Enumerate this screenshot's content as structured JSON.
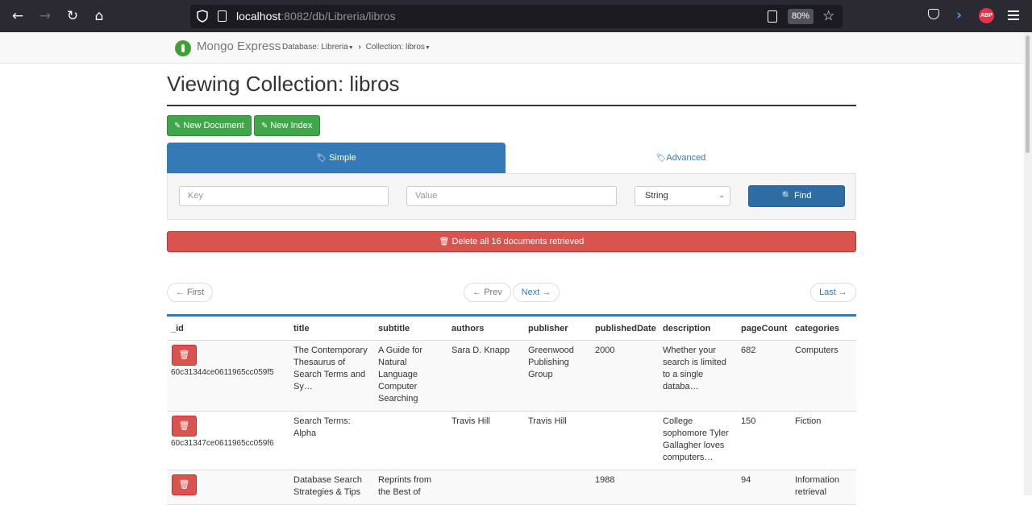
{
  "browser": {
    "url_host": "localhost",
    "url_path": ":8082/db/Libreria/libros",
    "zoom": "80%",
    "abp": "ABP"
  },
  "navbar": {
    "brand": "Mongo Express",
    "database_crumb": "Database: Libreria",
    "collection_crumb": "Collection: libros"
  },
  "page": {
    "title": "Viewing Collection: libros"
  },
  "toolbar": {
    "new_document": "New Document",
    "new_index": "New Index"
  },
  "search": {
    "tab_simple": "Simple",
    "tab_advanced": "Advanced",
    "key_placeholder": "Key",
    "value_placeholder": "Value",
    "type_selected": "String",
    "find_label": "Find"
  },
  "delete_all_label": "Delete all 16 documents retrieved",
  "pagination": {
    "first": "← First",
    "prev": "← Prev",
    "next": "Next →",
    "last": "Last →"
  },
  "table": {
    "columns": [
      "_id",
      "title",
      "subtitle",
      "authors",
      "publisher",
      "publishedDate",
      "description",
      "pageCount",
      "categories"
    ],
    "rows": [
      {
        "id": "60c31344ce0611965cc059f5",
        "title": "The Contemporary Thesaurus of Search Terms and Sy…",
        "subtitle": "A Guide for Natural Language Computer Searching",
        "authors": "Sara D. Knapp",
        "publisher": "Greenwood Publishing Group",
        "publishedDate": "2000",
        "description": "Whether your search is limited to a single databa…",
        "pageCount": "682",
        "categories": "Computers"
      },
      {
        "id": "60c31347ce0611965cc059f6",
        "title": "Search Terms: Alpha",
        "subtitle": "",
        "authors": "Travis Hill",
        "publisher": "Travis Hill",
        "publishedDate": "",
        "description": "College sophomore Tyler Gallagher loves computers…",
        "pageCount": "150",
        "categories": "Fiction"
      },
      {
        "id": "",
        "title": "Database Search Strategies & Tips",
        "subtitle": "Reprints from the Best of",
        "authors": "",
        "publisher": "",
        "publishedDate": "1988",
        "description": "",
        "pageCount": "94",
        "categories": "Information retrieval"
      }
    ]
  }
}
